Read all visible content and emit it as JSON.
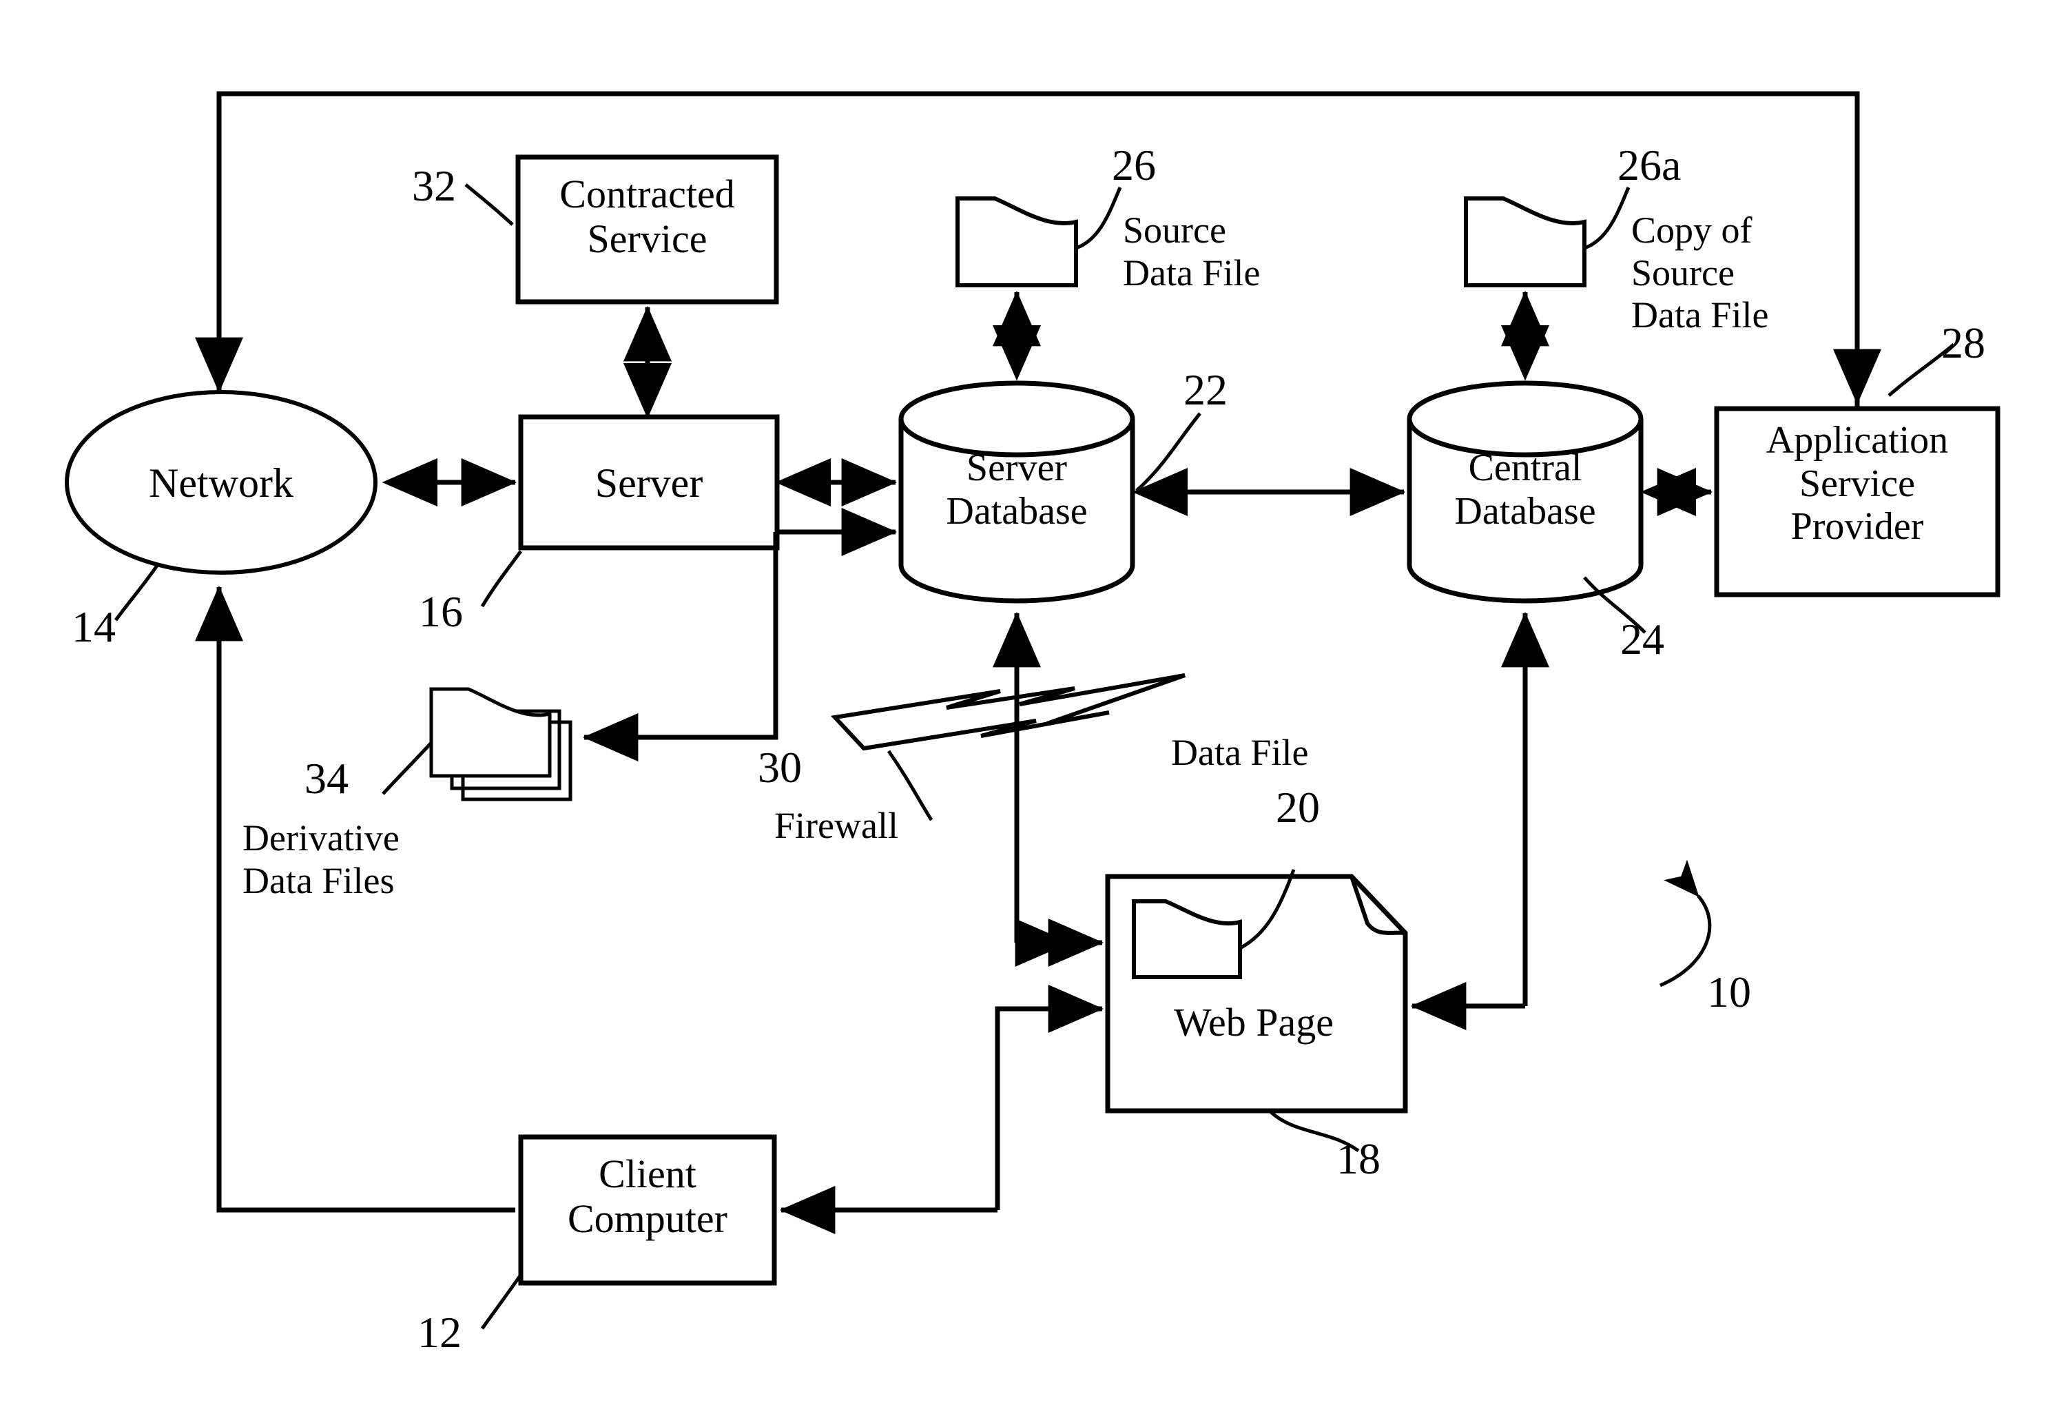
{
  "figure": {
    "title": "Network data distribution system block diagram",
    "reference_numeral_overall": "10",
    "stroke_color": "#000000",
    "background_color": "#ffffff"
  },
  "nodes": {
    "network": {
      "label": "Network",
      "ref": "14",
      "shape": "ellipse"
    },
    "server": {
      "label": "Server",
      "ref": "16",
      "shape": "rectangle"
    },
    "contracted_service": {
      "label": "Contracted\nService",
      "ref": "32",
      "shape": "rectangle"
    },
    "server_database": {
      "label": "Server\nDatabase",
      "ref": "22",
      "shape": "cylinder"
    },
    "central_database": {
      "label": "Central\nDatabase",
      "ref": "24",
      "shape": "cylinder"
    },
    "application_service_provider": {
      "label": "Application\nService\nProvider",
      "ref": "28",
      "shape": "rectangle"
    },
    "source_data_file": {
      "label": "Source\nData File",
      "ref": "26",
      "shape": "data-file"
    },
    "copy_of_source_data_file": {
      "label": "Copy of\nSource\nData File",
      "ref": "26a",
      "shape": "data-file"
    },
    "derivative_data_files": {
      "label": "Derivative\nData Files",
      "ref": "34",
      "shape": "stacked-data-files"
    },
    "firewall": {
      "label": "Firewall",
      "ref": "30",
      "shape": "lightning-bolt"
    },
    "web_page": {
      "label": "Web Page",
      "ref": "18",
      "shape": "page-with-folded-corner"
    },
    "data_file_in_web_page": {
      "label": "Data File",
      "ref": "20",
      "shape": "data-file"
    },
    "client_computer": {
      "label": "Client\nComputer",
      "ref": "12",
      "shape": "rectangle"
    }
  },
  "connections": [
    {
      "from": "application_service_provider",
      "to": "network",
      "style": "single-arrow-feedback-top"
    },
    {
      "from": "network",
      "to": "server",
      "style": "double-arrow"
    },
    {
      "from": "server",
      "to": "contracted_service",
      "style": "double-arrow"
    },
    {
      "from": "server",
      "to": "server_database",
      "style": "double-arrow"
    },
    {
      "from": "server",
      "to": "server_database",
      "style": "single-arrow-lower"
    },
    {
      "from": "server",
      "to": "derivative_data_files",
      "style": "single-arrow"
    },
    {
      "from": "server_database",
      "to": "source_data_file",
      "style": "double-arrow"
    },
    {
      "from": "server_database",
      "to": "central_database",
      "style": "double-arrow"
    },
    {
      "from": "central_database",
      "to": "copy_of_source_data_file",
      "style": "double-arrow"
    },
    {
      "from": "central_database",
      "to": "application_service_provider",
      "style": "double-arrow"
    },
    {
      "from": "web_page",
      "to": "server_database",
      "style": "single-arrow-up"
    },
    {
      "from": "web_page",
      "to": "central_database",
      "style": "single-arrow-up"
    },
    {
      "from": "central_database",
      "to": "web_page",
      "style": "single-arrow-left"
    },
    {
      "from": "client_computer",
      "to": "web_page",
      "style": "single-arrow"
    },
    {
      "from": "client_computer",
      "to": "network",
      "style": "single-arrow-up"
    },
    {
      "from": "web_page",
      "to": "client_computer",
      "style": "single-arrow-left"
    }
  ],
  "reference_numerals": [
    {
      "id": "10",
      "value": "10"
    },
    {
      "id": "12",
      "value": "12"
    },
    {
      "id": "14",
      "value": "14"
    },
    {
      "id": "16",
      "value": "16"
    },
    {
      "id": "18",
      "value": "18"
    },
    {
      "id": "20",
      "value": "20"
    },
    {
      "id": "22",
      "value": "22"
    },
    {
      "id": "24",
      "value": "24"
    },
    {
      "id": "26",
      "value": "26"
    },
    {
      "id": "26a",
      "value": "26a"
    },
    {
      "id": "28",
      "value": "28"
    },
    {
      "id": "30",
      "value": "30"
    },
    {
      "id": "32",
      "value": "32"
    },
    {
      "id": "34",
      "value": "34"
    }
  ]
}
